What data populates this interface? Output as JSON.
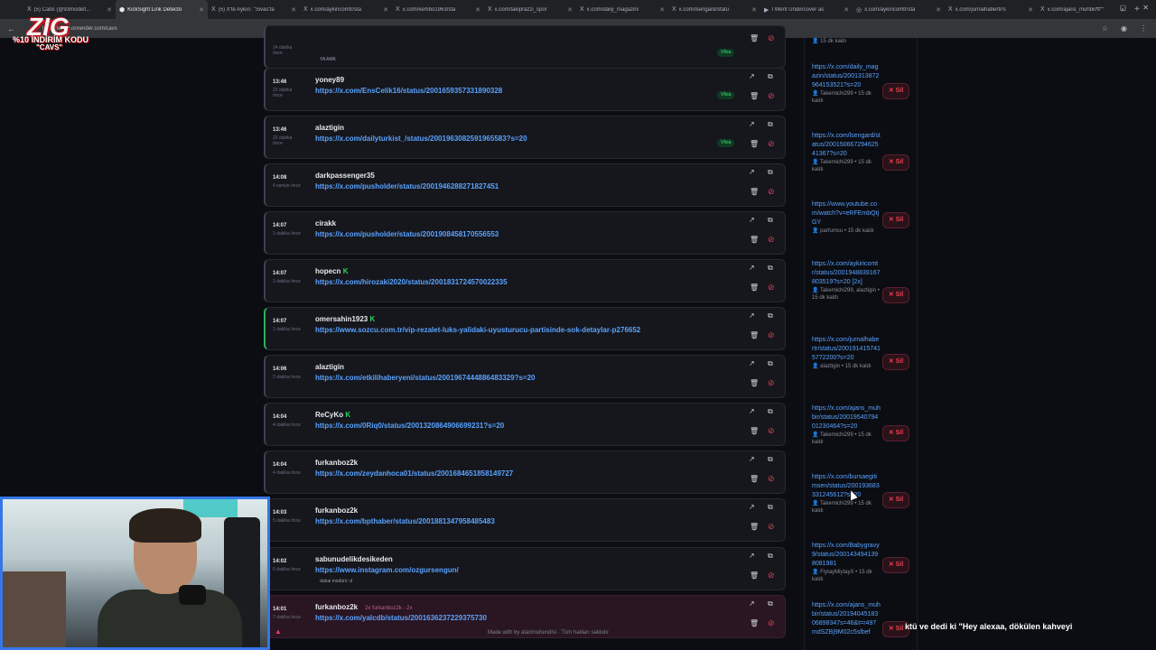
{
  "tabs": [
    {
      "icon": "X",
      "title": "(5) Cabs (@93modelt...",
      "active": false
    },
    {
      "icon": "⬢",
      "title": "KickSight Link Detecto",
      "active": true
    },
    {
      "icon": "X",
      "title": "(5) X'te Aykırı: \"Sivas'ta",
      "active": false
    },
    {
      "icon": "X",
      "title": "x.com/aykiricomtr/sta",
      "active": false
    },
    {
      "icon": "X",
      "title": "x.com/kembo1963/sta",
      "active": false
    },
    {
      "icon": "X",
      "title": "x.com/takiprazzi_spor",
      "active": false
    },
    {
      "icon": "X",
      "title": "x.com/daily_magazin/",
      "active": false
    },
    {
      "icon": "X",
      "title": "x.com/lsengard/statu",
      "active": false
    },
    {
      "icon": "▶",
      "title": "I Went Undercover as",
      "active": false
    },
    {
      "icon": "◎",
      "title": "x.com/aykiricomtr/sta",
      "active": false
    },
    {
      "icon": "X",
      "title": "x.com/jurnalhabertr/s",
      "active": false
    },
    {
      "icon": "X",
      "title": "x.com/ajans_muhbir/s",
      "active": false
    }
  ],
  "address": {
    "url": "linkdetector.onrender.com/cavs"
  },
  "overlay": {
    "logo": "ZIG",
    "promo": "%10 İNDİRİM KODU",
    "code": "\"CAVS\""
  },
  "rows": [
    {
      "time": "",
      "ago": "14 dakika önce",
      "user": "",
      "kick": false,
      "link": "",
      "note": "YA AMK",
      "badge": "Vİtsa",
      "green": false,
      "pink": false,
      "extra": ""
    },
    {
      "time": "13:46",
      "ago": "22 dakika önce",
      "user": "yoney89",
      "kick": false,
      "link": "https://x.com/EnsCelik16/status/2001659357331890328",
      "note": "",
      "badge": "Vİtsa",
      "green": false,
      "pink": false,
      "extra": ""
    },
    {
      "time": "13:46",
      "ago": "22 dakika önce",
      "user": "alaztigin",
      "kick": false,
      "link": "https://x.com/dailyturkist_/status/2001963082591965583?s=20",
      "note": "",
      "badge": "Vİtsa",
      "green": false,
      "pink": false,
      "extra": ""
    },
    {
      "time": "14:08",
      "ago": "4 saniye önce",
      "user": "darkpassenger35",
      "kick": false,
      "link": "https://x.com/pusholder/status/2001946288271827451",
      "note": "",
      "badge": "",
      "green": false,
      "pink": false,
      "extra": ""
    },
    {
      "time": "14:07",
      "ago": "1 dakika önce",
      "user": "cirakk",
      "kick": false,
      "link": "https://x.com/pusholder/status/2001908458170556553",
      "note": "",
      "badge": "",
      "green": false,
      "pink": false,
      "extra": ""
    },
    {
      "time": "14:07",
      "ago": "1 dakika önce",
      "user": "hopecn",
      "kick": true,
      "link": "https://x.com/hirozaki2020/status/2001831724570022335",
      "note": "",
      "badge": "",
      "green": false,
      "pink": false,
      "extra": ""
    },
    {
      "time": "14:07",
      "ago": "1 dakika önce",
      "user": "omersahin1923",
      "kick": true,
      "link": "https://www.sozcu.com.tr/vip-rezalet-luks-yalidaki-uyusturucu-partisinde-sok-detaylar-p276652",
      "note": "",
      "badge": "",
      "green": true,
      "pink": false,
      "extra": ""
    },
    {
      "time": "14:06",
      "ago": "2 dakika önce",
      "user": "alaztigin",
      "kick": false,
      "link": "https://x.com/etkilihaberyeni/status/2001967444886483329?s=20",
      "note": "",
      "badge": "",
      "green": false,
      "pink": false,
      "extra": ""
    },
    {
      "time": "14:04",
      "ago": "4 dakika önce",
      "user": "ReCyKo",
      "kick": true,
      "link": "https://x.com/0Riq0/status/2001320864906699231?s=20",
      "note": "",
      "badge": "",
      "green": false,
      "pink": false,
      "extra": ""
    },
    {
      "time": "14:04",
      "ago": "4 dakika önce",
      "user": "furkanboz2k",
      "kick": false,
      "link": "https://x.com/zeydanhoca01/status/2001684651858149727",
      "note": "",
      "badge": "",
      "green": false,
      "pink": false,
      "extra": ""
    },
    {
      "time": "14:03",
      "ago": "5 dakika önce",
      "user": "furkanboz2k",
      "kick": false,
      "link": "https://x.com/bpthaber/status/2001881347958485483",
      "note": "",
      "badge": "",
      "green": false,
      "pink": false,
      "extra": ""
    },
    {
      "time": "14:02",
      "ago": "6 dakika önce",
      "user": "sabunudelikdesikeden",
      "kick": false,
      "link": "https://www.instagram.com/ozgursengun/",
      "note": "dubai müdürü :d",
      "badge": "",
      "green": false,
      "pink": false,
      "extra": ""
    },
    {
      "time": "14:01",
      "ago": "7 dakika önce",
      "user": "furkanboz2k",
      "kick": false,
      "link": "https://x.com/yalcdb/status/2001636237229375730",
      "note": "",
      "badge": "",
      "green": false,
      "pink": true,
      "extra": "2x   furkanboz2k - 2x"
    }
  ],
  "side": [
    {
      "link": "",
      "meta": "15 dk kaldı"
    },
    {
      "link": "https://x.com/daily_magazin/status/2001313872964153521?s=20",
      "meta": "Takemichi299 • 15 dk kaldı"
    },
    {
      "link": "https://x.com/lsengard/status/2001506672946254136​7?s=20",
      "meta": "Takemichi299 • 15 dk kaldı"
    },
    {
      "link": "https://www.youtube.com/watch?v=eRFEmbQtjGY",
      "meta": "parfumcu • 15 dk kaldı"
    },
    {
      "link": "https://x.com/aykiricomtr/status/20019488391678035​19?s=20 [2x]",
      "meta": "Takemichi299, alaztigin • 15 dk kaldı"
    },
    {
      "link": "https://x.com/jurnalhabertr/status/2001914157415772200?s=20",
      "meta": "alaztigin • 15 dk kaldı"
    },
    {
      "link": "https://x.com/ajans_muhbir/status/2001954079401230464?s=20",
      "meta": "Takemichi299 • 15 dk kaldı"
    },
    {
      "link": "https://x.com/bursaegitimsen/status/200193683331245612?s=20",
      "meta": "Takemichi299 • 15 dk kaldı"
    },
    {
      "link": "https://x.com/Babygravy9/status/20014349413980819​81",
      "meta": "FiytayMiytayX • 15 dk kaldı"
    },
    {
      "link": "https://x.com/ajans_muhbir/status/2019404518306898347s=46&t=r497mdSZBj9M02c5slbef",
      "meta": ""
    }
  ],
  "sil_label": "✕ Sil",
  "footer": "Made with  by  atarimuhendisi  · Tüm hakları saklıdır",
  "caption": "ktü ve dedi ki \"Hey alexaa, dökülen kahveyi"
}
